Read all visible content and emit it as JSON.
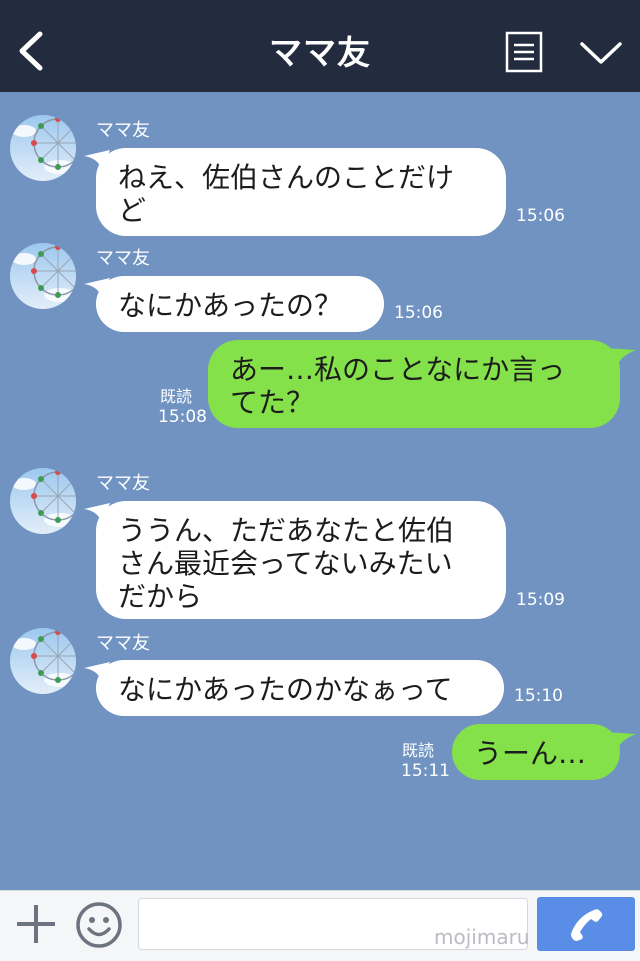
{
  "header": {
    "title": "ママ友",
    "icons": {
      "back": "chevron-left-icon",
      "menu": "menu-list-icon",
      "collapse": "chevron-down-icon"
    }
  },
  "messages": [
    {
      "id": "m1",
      "direction": "incoming",
      "sender": "ママ友",
      "text": "ねえ、佐伯さんのことだけ\nど",
      "time": "15:06"
    },
    {
      "id": "m2",
      "direction": "incoming",
      "sender": "ママ友",
      "text": "なにかあったの？",
      "time": "15:06"
    },
    {
      "id": "m3",
      "direction": "outgoing",
      "text": "あー…私のことなにか言っ\nてた？",
      "read": "既読",
      "time": "15:08"
    },
    {
      "id": "m4",
      "direction": "incoming",
      "sender": "ママ友",
      "text": "ううん、ただあなたと佐伯\nさん最近会ってないみたい\nだから",
      "time": "15:09"
    },
    {
      "id": "m5",
      "direction": "incoming",
      "sender": "ママ友",
      "text": "なにかあったのかなぁって",
      "time": "15:10"
    },
    {
      "id": "m6",
      "direction": "outgoing",
      "text": "うーん…",
      "read": "既読",
      "time": "15:11"
    }
  ],
  "input_bar": {
    "message_value": "",
    "watermark": "mojimaru",
    "icons": {
      "plus": "plus-icon",
      "emoji": "smiley-icon",
      "call": "phone-icon"
    }
  },
  "colors": {
    "header_bg": "#232b3e",
    "chat_bg": "#7093c2",
    "incoming_bubble": "#ffffff",
    "outgoing_bubble": "#84e14a",
    "call_button": "#5a8ee6"
  }
}
